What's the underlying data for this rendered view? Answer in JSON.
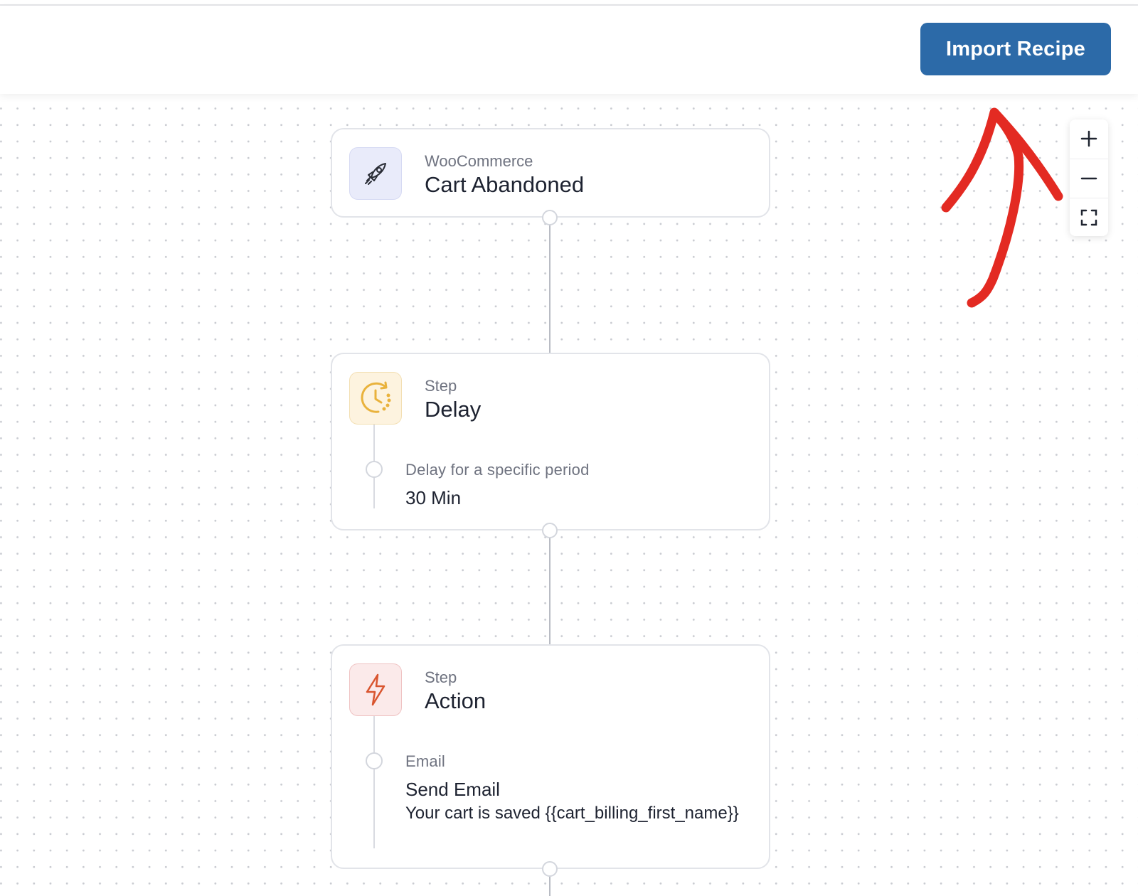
{
  "header": {
    "import_label": "Import Recipe"
  },
  "zoom_controls": {
    "zoom_in": "plus-icon",
    "zoom_out": "minus-icon",
    "fit": "fit-view-icon"
  },
  "nodes": [
    {
      "icon": "rocket-icon",
      "kicker": "WooCommerce",
      "title": "Cart Abandoned"
    },
    {
      "icon": "clock-icon",
      "kicker": "Step",
      "title": "Delay",
      "sub_label": "Delay for a specific period",
      "sub_value": "30 Min"
    },
    {
      "icon": "lightning-icon",
      "kicker": "Step",
      "title": "Action",
      "sub_label": "Email",
      "sub_value": "Send Email",
      "sub_text": "Your cart is saved {{cart_billing_first_name}}"
    }
  ],
  "colors": {
    "primary_button": "#2c6aa8",
    "annotation_arrow": "#e32a22"
  }
}
